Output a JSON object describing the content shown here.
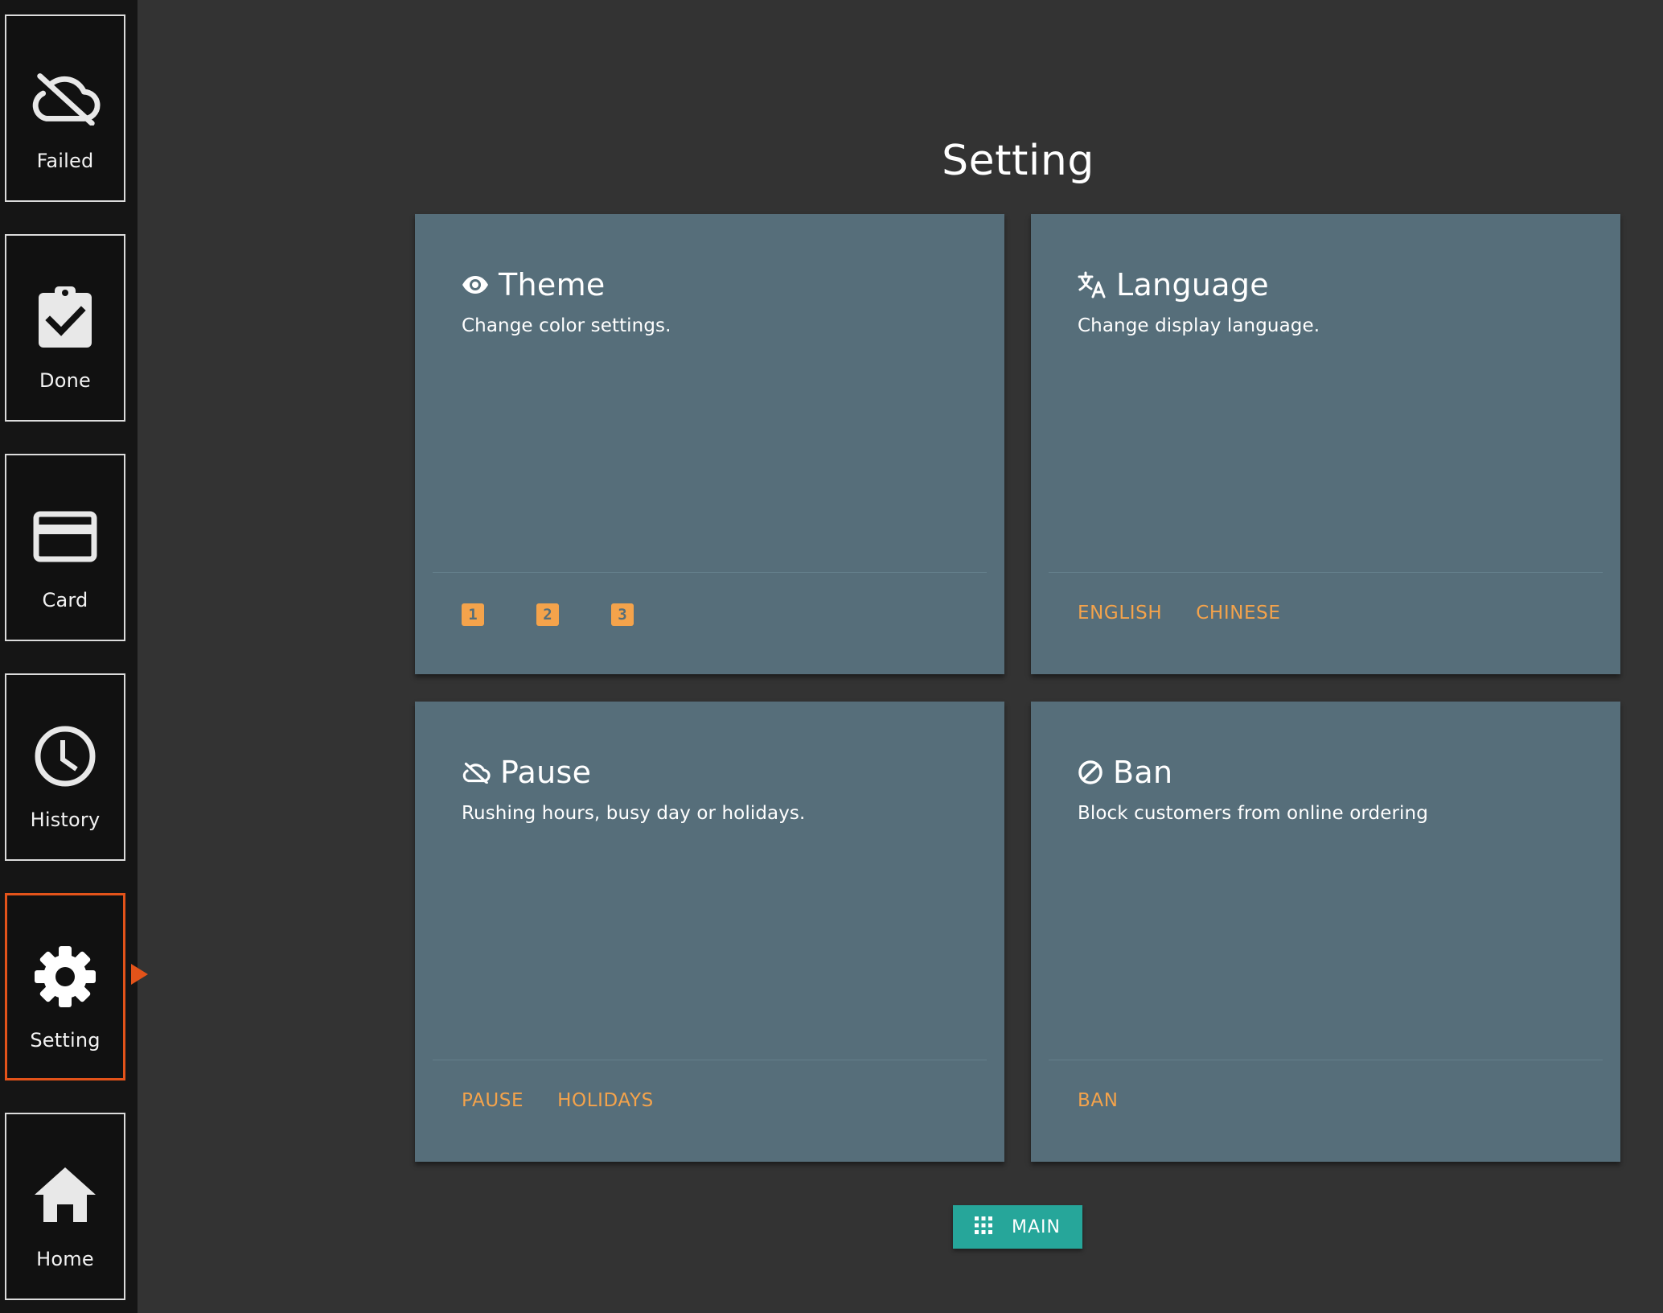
{
  "sidebar": {
    "items": [
      {
        "label": "Failed",
        "icon": "cloud-off-icon"
      },
      {
        "label": "Done",
        "icon": "clipboard-check-icon"
      },
      {
        "label": "Card",
        "icon": "credit-card-icon"
      },
      {
        "label": "History",
        "icon": "clock-icon"
      },
      {
        "label": "Setting",
        "icon": "gear-icon",
        "active": true
      },
      {
        "label": "Home",
        "icon": "home-icon"
      }
    ]
  },
  "page": {
    "title": "Setting"
  },
  "cards": {
    "theme": {
      "title": "Theme",
      "description": "Change color settings.",
      "icon": "eye-icon",
      "options": [
        "1",
        "2",
        "3"
      ]
    },
    "language": {
      "title": "Language",
      "description": "Change display language.",
      "icon": "translate-icon",
      "actions": [
        "ENGLISH",
        "CHINESE"
      ]
    },
    "pause": {
      "title": "Pause",
      "description": "Rushing hours, busy day or holidays.",
      "icon": "cloud-off-icon",
      "actions": [
        "PAUSE",
        "HOLIDAYS"
      ]
    },
    "ban": {
      "title": "Ban",
      "description": "Block customers from online ordering",
      "icon": "block-icon",
      "actions": [
        "BAN"
      ]
    }
  },
  "main_button": {
    "label": "MAIN",
    "icon": "apps-grid-icon"
  },
  "colors": {
    "background": "#333333",
    "sidebar": "#151515",
    "card": "#566e7a",
    "accent": "#f4a34b",
    "active": "#e3531a",
    "button": "#26a69a"
  }
}
